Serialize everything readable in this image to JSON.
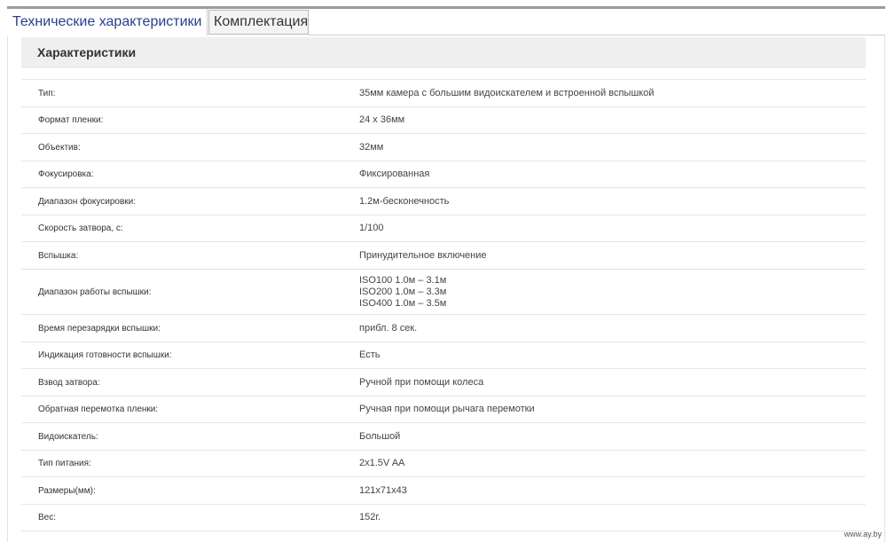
{
  "tabs": [
    {
      "label": "Технические характеристики",
      "active": true
    },
    {
      "label": "Комплектация",
      "active": false
    }
  ],
  "section": {
    "title": "Характеристики"
  },
  "specs": [
    {
      "label": "Тип:",
      "value": [
        "35мм камера с большим видоискателем и встроенной вспышкой"
      ]
    },
    {
      "label": "Формат пленки:",
      "value": [
        "24 x 36мм"
      ]
    },
    {
      "label": "Объектив:",
      "value": [
        "32мм"
      ]
    },
    {
      "label": "Фокусировка:",
      "value": [
        "Фиксированная"
      ]
    },
    {
      "label": "Диапазон фокусировки:",
      "value": [
        "1.2м-бесконечность"
      ]
    },
    {
      "label": "Скорость затвора, с:",
      "value": [
        "1/100"
      ]
    },
    {
      "label": "Вспышка:",
      "value": [
        "Принудительное включение"
      ]
    },
    {
      "label": "Диапазон работы вспышки:",
      "value": [
        "ISO100 1.0м – 3.1м",
        "ISO200 1.0м – 3.3м",
        "ISO400 1.0м – 3.5м"
      ]
    },
    {
      "label": "Время перезарядки вспышки:",
      "value": [
        "прибл. 8 сек."
      ]
    },
    {
      "label": "Индикация готовности вспышки:",
      "value": [
        "Есть"
      ]
    },
    {
      "label": "Взвод затвора:",
      "value": [
        "Ручной при помощи колеса"
      ]
    },
    {
      "label": "Обратная перемотка пленки:",
      "value": [
        "Ручная при помощи рычага перемотки"
      ]
    },
    {
      "label": "Видоискатель:",
      "value": [
        "Большой"
      ]
    },
    {
      "label": "Тип питания:",
      "value": [
        "2x1.5V AA"
      ]
    },
    {
      "label": "Размеры(мм):",
      "value": [
        "121x71x43"
      ]
    },
    {
      "label": "Вес:",
      "value": [
        "152г."
      ]
    }
  ],
  "watermark": "www.ay.by"
}
